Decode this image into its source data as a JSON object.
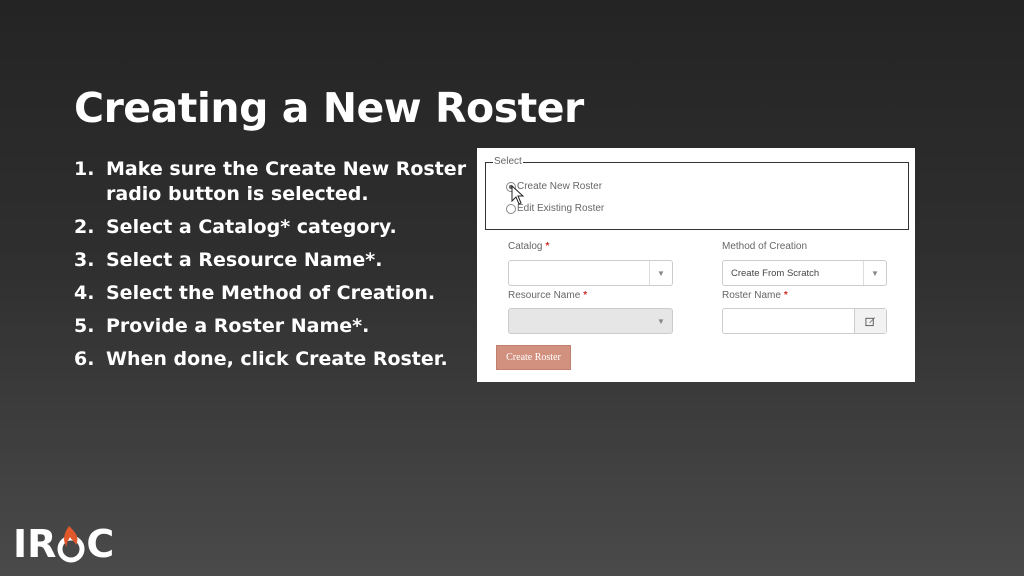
{
  "slide": {
    "title": "Creating a New Roster",
    "steps": [
      {
        "num": "1.",
        "text": "Make sure the Create New Roster radio button is selected."
      },
      {
        "num": "2.",
        "text": "Select a Catalog* category."
      },
      {
        "num": "3.",
        "text": "Select a Resource Name*."
      },
      {
        "num": "4.",
        "text": "Select the Method of Creation."
      },
      {
        "num": "5.",
        "text": "Provide a Roster Name*."
      },
      {
        "num": "6.",
        "text": "When done, click Create Roster."
      }
    ]
  },
  "form": {
    "select_legend": "Select",
    "radio_create_label": "Create New Roster",
    "radio_edit_label": "Edit Existing Roster",
    "selected_radio": "Create New Roster",
    "catalog_label": "Catalog",
    "catalog_value": "",
    "resource_name_label": "Resource Name",
    "resource_name_value": "",
    "method_label": "Method of Creation",
    "method_value": "Create From Scratch",
    "roster_name_label": "Roster Name",
    "roster_name_value": "",
    "required_mark": "*",
    "submit_label": "Create Roster"
  },
  "colors": {
    "title": "#ffffff",
    "required": "#c9302c",
    "submit_button": "#d2917f",
    "logo_flame": "#e2582a"
  },
  "logo": {
    "before": "IR",
    "after": "C",
    "flame_icon": "flame-icon"
  }
}
